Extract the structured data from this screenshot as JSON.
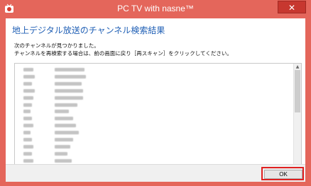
{
  "window": {
    "title": "PC TV with nasne™",
    "close_label": "✕"
  },
  "dialog": {
    "heading": "地上デジタル放送のチャンネル検索結果",
    "message_line1": "次のチャンネルが見つかりました。",
    "message_line2": "チャンネルを再検索する場合は、前の画面に戻り［再スキャン］をクリックしてください。",
    "ok_label": "OK"
  },
  "channel_list": {
    "row_count": 14,
    "content_state": "blurred"
  },
  "colors": {
    "titlebar": "#e4665b",
    "heading": "#1f5fb5",
    "highlight": "#e02020"
  }
}
